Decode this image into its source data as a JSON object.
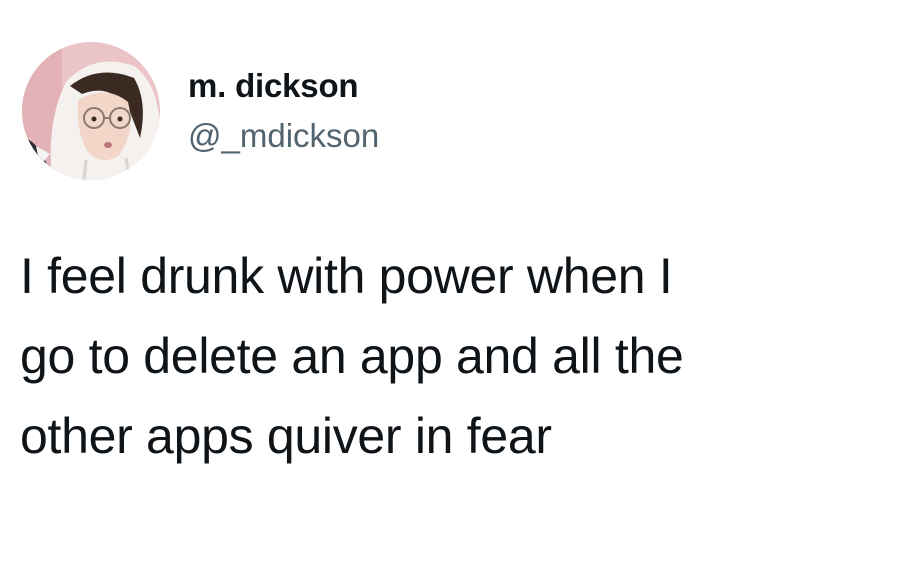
{
  "tweet": {
    "author": {
      "name": "m. dickson",
      "handle": "@_mdickson"
    },
    "text": "I feel drunk with power when I\ngo to delete an app and all the\nother apps quiver in fear"
  }
}
